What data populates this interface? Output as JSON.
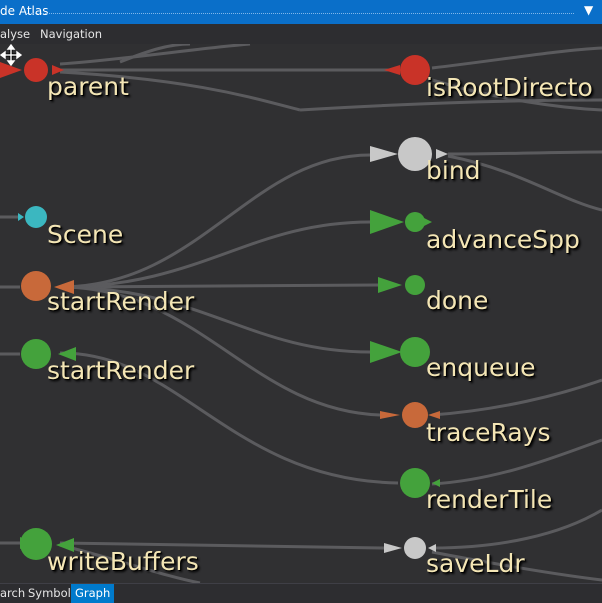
{
  "window": {
    "title": "de Atlas"
  },
  "menu": {
    "items": [
      "alyse",
      "Navigation"
    ]
  },
  "graph": {
    "colors": {
      "red": "#c93328",
      "cyan": "#3bb7c0",
      "orange": "#c8693a",
      "green": "#44a23c",
      "grey": "#c8c8c8",
      "edge": "#5b5b5e"
    },
    "nodes": [
      {
        "id": "parent",
        "label": "parent",
        "color": "red"
      },
      {
        "id": "isRootDirectory",
        "label": "isRootDirecto",
        "color": "red"
      },
      {
        "id": "bind",
        "label": "bind",
        "color": "grey"
      },
      {
        "id": "scene",
        "label": "Scene",
        "color": "cyan"
      },
      {
        "id": "advanceSpp",
        "label": "advanceSpp",
        "color": "green"
      },
      {
        "id": "startRender1",
        "label": "startRender",
        "color": "orange"
      },
      {
        "id": "done",
        "label": "done",
        "color": "green"
      },
      {
        "id": "startRender2",
        "label": "startRender",
        "color": "green"
      },
      {
        "id": "enqueue",
        "label": "enqueue",
        "color": "green"
      },
      {
        "id": "traceRays",
        "label": "traceRays",
        "color": "orange"
      },
      {
        "id": "renderTile",
        "label": "renderTile",
        "color": "green"
      },
      {
        "id": "writeBuffers",
        "label": "writeBuffers",
        "color": "green"
      },
      {
        "id": "saveLdr",
        "label": "saveLdr",
        "color": "grey"
      }
    ]
  },
  "tabs": [
    {
      "label": "arch",
      "active": false
    },
    {
      "label": "Symbol",
      "active": false
    },
    {
      "label": "Graph",
      "active": true
    }
  ],
  "icons": {
    "pan": "move-cursor-icon"
  }
}
